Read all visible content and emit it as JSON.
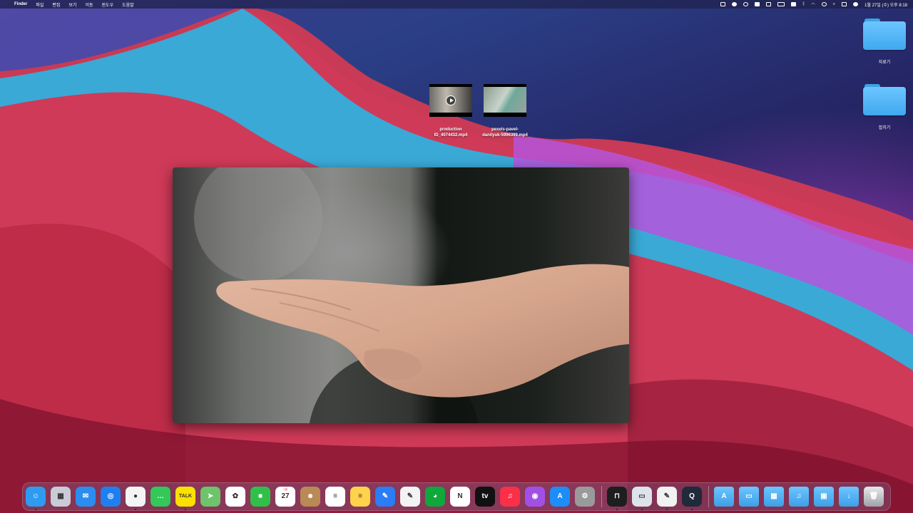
{
  "menubar": {
    "apple_glyph": "",
    "app_name": "Finder",
    "menus": [
      "파일",
      "편집",
      "보기",
      "이동",
      "윈도우",
      "도움말"
    ],
    "clock": "1월 27일 (수) 오후 8:18",
    "status_icons": [
      "screen-mirror-icon",
      "cloud-icon",
      "vpn-icon",
      "shield-icon",
      "grid-icon",
      "battery-icon",
      "b-icon",
      "bluetooth-icon",
      "wifi-icon",
      "user-icon",
      "search-icon",
      "control-center-icon",
      "siri-icon"
    ]
  },
  "desktop": {
    "folders": [
      {
        "name": "자료기",
        "icon": "folder-icon"
      },
      {
        "name": "합치기",
        "icon": "folder-icon"
      }
    ],
    "files": [
      {
        "name": "production ID_4074432.mp4",
        "line1": "production",
        "line2": "ID_4074432.mp4",
        "has_play": true
      },
      {
        "name": "pexels-pavel-danilyuk-5996399.mp4",
        "line1": "pexels-pavel-",
        "line2": "danilyuk-5996399.mp4",
        "has_play": false
      }
    ]
  },
  "video_preview": {
    "subject": "open-hand"
  },
  "dock": {
    "apps": [
      {
        "id": "finder",
        "color": "#2e9bf0",
        "glyph": "☺",
        "running": true
      },
      {
        "id": "launchpad",
        "color": "#c9ccd6",
        "glyph": "▦",
        "running": false
      },
      {
        "id": "mail",
        "color": "#2c8df0",
        "glyph": "✉",
        "running": false
      },
      {
        "id": "safari",
        "color": "#1f7ff0",
        "glyph": "◎",
        "running": false
      },
      {
        "id": "chrome",
        "color": "#f4f4f4",
        "glyph": "●",
        "running": true
      },
      {
        "id": "messages",
        "color": "#34c759",
        "glyph": "…",
        "running": false
      },
      {
        "id": "kakaotalk",
        "color": "#fae100",
        "glyph": "TALK",
        "running": true
      },
      {
        "id": "maps",
        "color": "#6dc46a",
        "glyph": "➤",
        "running": false
      },
      {
        "id": "photos",
        "color": "#ffffff",
        "glyph": "✿",
        "running": false
      },
      {
        "id": "facetime",
        "color": "#30c04a",
        "glyph": "■",
        "running": false
      },
      {
        "id": "calendar",
        "color": "#ffffff",
        "glyph": "27",
        "label": "1월",
        "running": false
      },
      {
        "id": "contacts",
        "color": "#b98a55",
        "glyph": "☻",
        "running": false
      },
      {
        "id": "reminders",
        "color": "#ffffff",
        "glyph": "≡",
        "running": false
      },
      {
        "id": "notes",
        "color": "#ffd24c",
        "glyph": "≡",
        "running": false
      },
      {
        "id": "pages",
        "color": "#2a7df5",
        "glyph": "✎",
        "running": false
      },
      {
        "id": "textedit",
        "color": "#f3f3f3",
        "glyph": "✎",
        "running": false
      },
      {
        "id": "evernote",
        "color": "#0fa83b",
        "glyph": "◕",
        "running": false
      },
      {
        "id": "notion",
        "color": "#ffffff",
        "glyph": "N",
        "running": false
      },
      {
        "id": "appletv",
        "color": "#111111",
        "glyph": "tv",
        "running": false
      },
      {
        "id": "music",
        "color": "#fa2f48",
        "glyph": "♫",
        "running": false
      },
      {
        "id": "podcasts",
        "color": "#a150e6",
        "glyph": "◉",
        "running": false
      },
      {
        "id": "appstore",
        "color": "#1d8df7",
        "glyph": "A",
        "running": false
      },
      {
        "id": "system-preferences",
        "color": "#9a9a9a",
        "glyph": "⚙",
        "running": false
      },
      {
        "id": "screen-recorder",
        "color": "#1e1e1e",
        "glyph": "⊓",
        "running": true
      },
      {
        "id": "preview-monitor",
        "color": "#dde3ea",
        "glyph": "▭",
        "running": true
      },
      {
        "id": "script-editor",
        "color": "#f1f1f1",
        "glyph": "✎",
        "running": true
      },
      {
        "id": "quicktime",
        "color": "#1f2a3a",
        "glyph": "Q",
        "running": true
      }
    ],
    "folders": [
      {
        "id": "applications",
        "glyph": "A"
      },
      {
        "id": "documents",
        "glyph": "▭"
      },
      {
        "id": "movies",
        "glyph": "▦"
      },
      {
        "id": "music",
        "glyph": "♫"
      },
      {
        "id": "pictures",
        "glyph": "▣"
      },
      {
        "id": "downloads",
        "glyph": "↓"
      }
    ],
    "trash": {
      "id": "trash",
      "glyph": "🗑"
    }
  }
}
